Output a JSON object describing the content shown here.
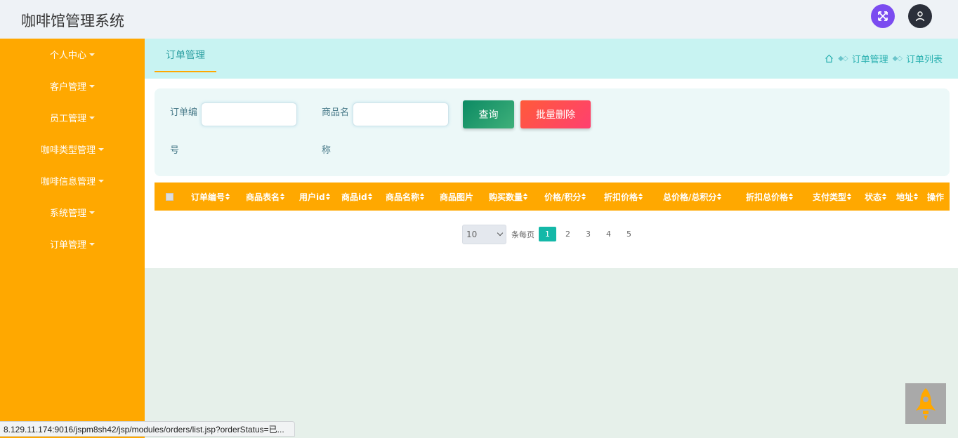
{
  "header": {
    "title": "咖啡馆管理系统"
  },
  "sidebar": {
    "items": [
      {
        "label": "个人中心"
      },
      {
        "label": "客户管理"
      },
      {
        "label": "员工管理"
      },
      {
        "label": "咖啡类型管理"
      },
      {
        "label": "咖啡信息管理"
      },
      {
        "label": "系统管理"
      },
      {
        "label": "订单管理"
      }
    ]
  },
  "topbar": {
    "tab_label": "订单管理",
    "breadcrumb": [
      "订单管理",
      "订单列表"
    ]
  },
  "search": {
    "order_no_label": "订单编号",
    "product_name_label": "商品名称",
    "order_no_value": "",
    "product_name_value": "",
    "query_button": "查询",
    "batch_delete_button": "批量删除"
  },
  "table": {
    "columns": [
      {
        "label": "订单编号",
        "sortable": true
      },
      {
        "label": "商品表名",
        "sortable": true
      },
      {
        "label": "用户id",
        "sortable": true
      },
      {
        "label": "商品id",
        "sortable": true
      },
      {
        "label": "商品名称",
        "sortable": true
      },
      {
        "label": "商品图片",
        "sortable": false
      },
      {
        "label": "购买数量",
        "sortable": true
      },
      {
        "label": "价格/积分",
        "sortable": true
      },
      {
        "label": "折扣价格",
        "sortable": true
      },
      {
        "label": "总价格/总积分",
        "sortable": true
      },
      {
        "label": "折扣总价格",
        "sortable": true
      },
      {
        "label": "支付类型",
        "sortable": true
      },
      {
        "label": "状态",
        "sortable": true
      },
      {
        "label": "地址",
        "sortable": true
      },
      {
        "label": "操作",
        "sortable": false
      }
    ],
    "rows": []
  },
  "pager": {
    "page_size": "10",
    "per_page_label": "条每页",
    "pages": [
      "1",
      "2",
      "3",
      "4",
      "5"
    ],
    "current_page": "1"
  },
  "status_bar": {
    "url": "8.129.11.174:9016/jspm8sh42/jsp/modules/orders/list.jsp?orderStatus=已..."
  },
  "colors": {
    "sidebar": "#ffa800",
    "topbar": "#c8f3f2",
    "accent_teal": "#14b8a8",
    "query_green": "#0c8a63",
    "delete_red": "#ff4a50"
  },
  "icons": {
    "fullscreen": "expand-arrows-icon",
    "user": "user-icon",
    "home": "home-icon",
    "back_to_top": "rocket-icon"
  }
}
